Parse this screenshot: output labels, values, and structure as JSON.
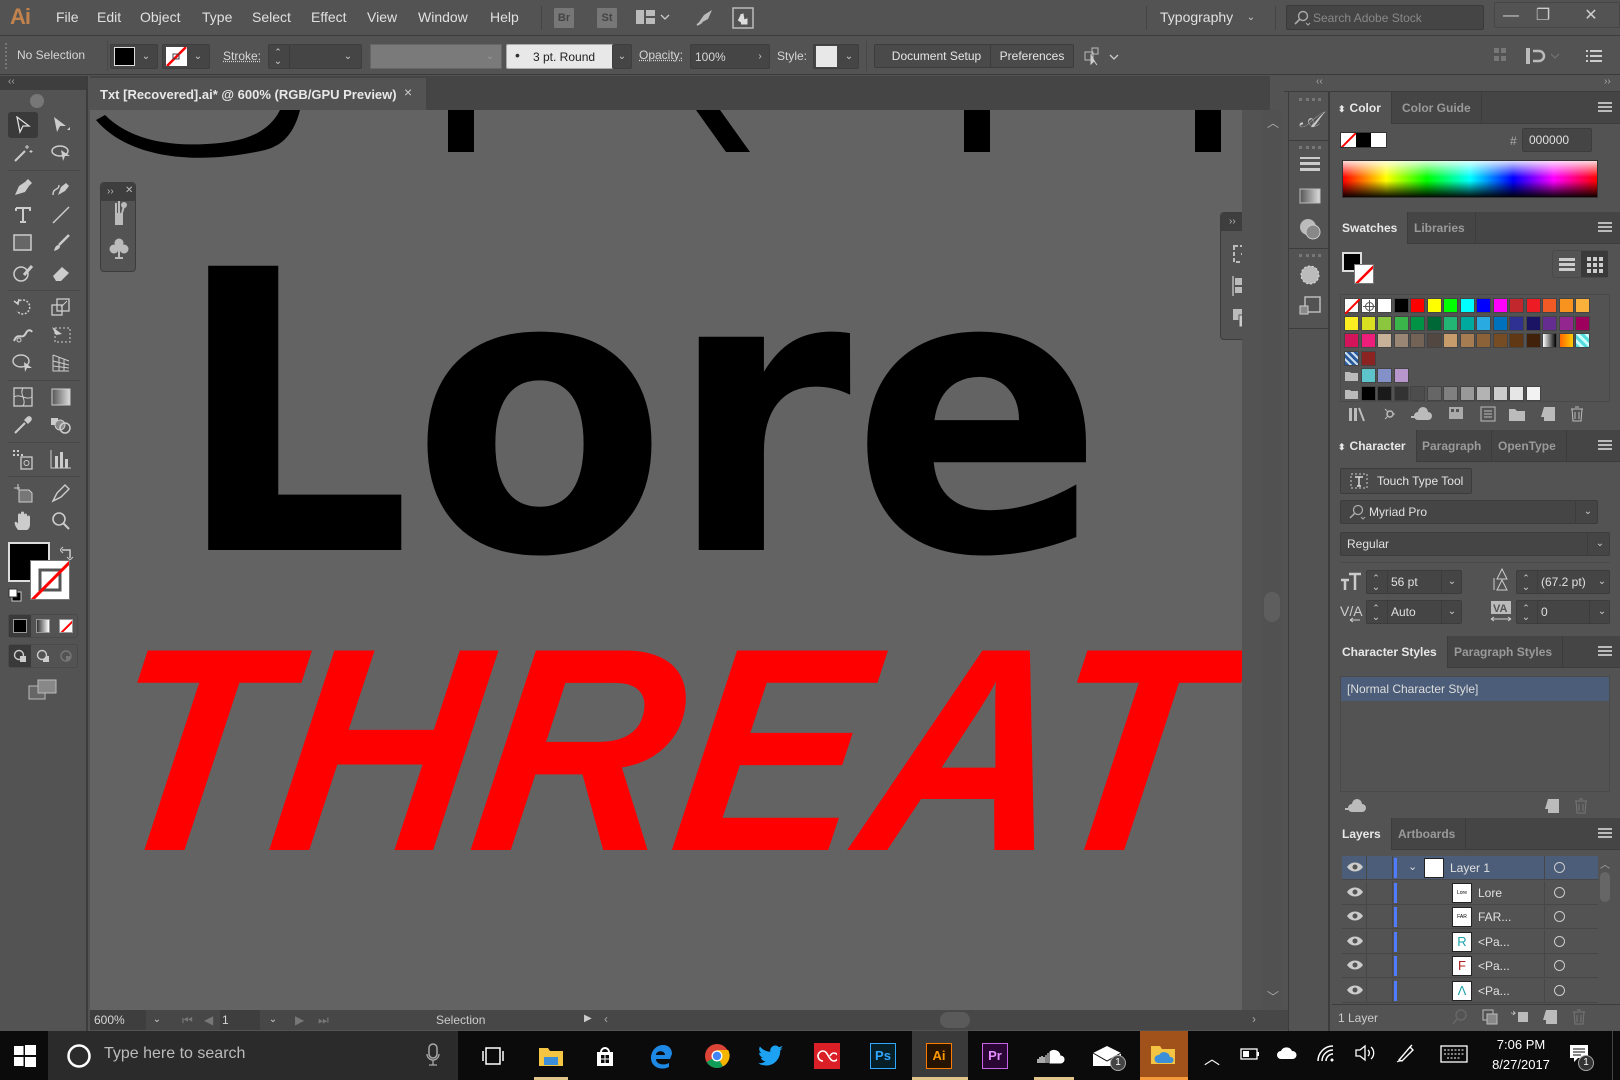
{
  "app": {
    "logo": "Ai",
    "menu": [
      "File",
      "Edit",
      "Object",
      "Type",
      "Select",
      "Effect",
      "View",
      "Window",
      "Help"
    ],
    "bridge_buttons": [
      "Br",
      "St"
    ],
    "workspace": "Typography",
    "search_placeholder": "Search Adobe Stock",
    "window_buttons": {
      "minimize": "—",
      "restore": "❐",
      "close": "✕"
    }
  },
  "control_bar": {
    "selection_label": "No Selection",
    "stroke_label": "Stroke:",
    "stroke_value": "",
    "brush_label": "3 pt. Round",
    "opacity_label": "Opacity:",
    "opacity_value": "100%",
    "style_label": "Style:",
    "document_setup": "Document Setup",
    "preferences": "Preferences"
  },
  "document": {
    "tab_title": "Txt [Recovered].ai* @ 600% (RGB/GPU Preview)",
    "close": "×",
    "canvas_text_black": "Lore",
    "canvas_text_red": "THREAT",
    "red_color": "#ff0000",
    "canvas_bg": "#636363"
  },
  "status_bar": {
    "zoom": "600%",
    "artboard": "1",
    "tool": "Selection"
  },
  "color_panel": {
    "tabs": [
      "Color",
      "Color Guide"
    ],
    "hex_label": "#",
    "hex_value": "000000"
  },
  "swatches_panel": {
    "tabs": [
      "Swatches",
      "Libraries"
    ],
    "rows": [
      [
        "none",
        "registration",
        "#ffffff",
        "#000000",
        "#ff0000",
        "#ffff00",
        "#00ff00",
        "#00ffff",
        "#0000ff",
        "#ff00ff",
        "#c1272d",
        "#ed1c24",
        "#f15a24",
        "#f7931e",
        "#fbb03b"
      ],
      [
        "#fcee21",
        "#d9e021",
        "#8cc63f",
        "#39b54a",
        "#009245",
        "#006837",
        "#22b573",
        "#00a99d",
        "#29abe2",
        "#0071bc",
        "#2e3192",
        "#1b1464",
        "#662d91",
        "#93278f",
        "#9e005d"
      ],
      [
        "#d4145a",
        "#ed1e79",
        "#c7b299",
        "#998675",
        "#736357",
        "#534741",
        "#c69c6d",
        "#a67c52",
        "#8c6239",
        "#754c24",
        "#603813",
        "#42210b",
        "gradient-bw",
        "gradient-orange",
        "pattern-cyan"
      ],
      [
        "pattern-blue",
        "#8b2323"
      ],
      [
        "folder",
        "#5ec4cc",
        "#8491c8",
        "#b796cb"
      ],
      [
        "folder",
        "#000000",
        "#1a1a1a",
        "#333333",
        "#4d4d4d",
        "#666666",
        "#808080",
        "#999999",
        "#b3b3b3",
        "#cccccc",
        "#e6e6e6",
        "#f2f2f2"
      ]
    ]
  },
  "character_panel": {
    "tabs": [
      "Character",
      "Paragraph",
      "OpenType"
    ],
    "touch_type": "Touch Type Tool",
    "font_family": "Myriad Pro",
    "font_style": "Regular",
    "font_size": "56 pt",
    "leading": "(67.2 pt)",
    "kerning": "Auto",
    "tracking": "0"
  },
  "styles_panel": {
    "tabs": [
      "Character Styles",
      "Paragraph Styles"
    ],
    "items": [
      "[Normal Character Style]"
    ]
  },
  "layers_panel": {
    "tabs": [
      "Layers",
      "Artboards"
    ],
    "rows": [
      {
        "name": "Layer 1",
        "level": 0,
        "selected": true
      },
      {
        "name": "Lore",
        "level": 1,
        "selected": false
      },
      {
        "name": "FAR...",
        "level": 1,
        "selected": false
      },
      {
        "name": "<Pa...",
        "level": 1,
        "selected": false
      },
      {
        "name": "<Pa...",
        "level": 1,
        "selected": false
      },
      {
        "name": "<Pa...",
        "level": 1,
        "selected": false
      }
    ],
    "footer": "1 Layer"
  },
  "taskbar": {
    "search_placeholder": "Type here to search",
    "apps": [
      "task-view",
      "file-explorer",
      "store",
      "edge",
      "chrome",
      "twitter",
      "creative-cloud",
      "photoshop",
      "illustrator",
      "premiere",
      "soundcloud",
      "mail",
      "onedrive-folder"
    ],
    "app_labels": {
      "photoshop": "Ps",
      "illustrator": "Ai",
      "premiere": "Pr"
    },
    "mail_badge": "1",
    "notification_badge": "1",
    "time": "7:06 PM",
    "date": "8/27/2017"
  }
}
